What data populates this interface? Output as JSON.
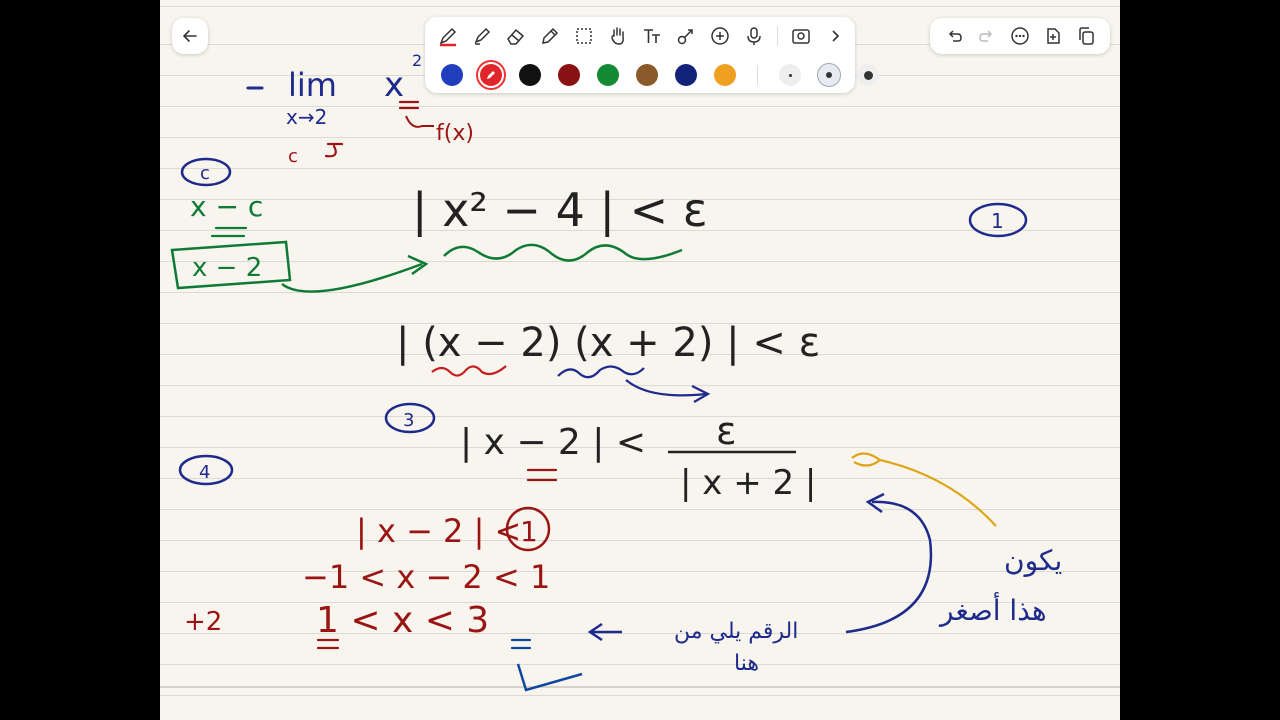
{
  "toolbar": {
    "tools": [
      "pen",
      "highlighter",
      "eraser",
      "pencil",
      "lasso-select",
      "hand",
      "text",
      "shape",
      "add",
      "microphone",
      "photo",
      "more"
    ],
    "active_tool": "pen",
    "colors": [
      "#1f3fbf",
      "#e0262b",
      "#111111",
      "#8a1212",
      "#138a36",
      "#8a5a2a",
      "#13237a",
      "#f0a020"
    ],
    "selected_color": "#e0262b",
    "stroke_widths": [
      "thin",
      "medium",
      "thick"
    ],
    "selected_width": "medium"
  },
  "header_right": {
    "buttons": [
      "undo",
      "redo",
      "more-options",
      "add-page",
      "copy-page"
    ]
  },
  "ink_colors": {
    "blue": "#1e2a8c",
    "green": "#0f7a35",
    "red": "#9a1414",
    "black": "#222222",
    "gold": "#e0a418"
  },
  "notes": {
    "limit_word": "lim",
    "limit_sub": "x→2",
    "limit_expr": "x",
    "limit_exp": "2",
    "fx_label": "f(x)",
    "c_label": "c",
    "circle_c": "c",
    "x_minus_c": "x − c",
    "boxed_x_minus_2": "x − 2",
    "step1_lhs": "| x² − 4 | < ε",
    "step1_circle": "1",
    "step2": "| (x − 2) (x + 2) | < ε",
    "step3_circle": "3",
    "step3_lhs": "| x − 2 | <",
    "step3_num": "ε",
    "step3_den": "| x + 2 |",
    "step4_circle": "4",
    "ineq1_lhs": "| x − 2 | <",
    "ineq1_circled": "1",
    "ineq2": "−1  < x − 2 < 1",
    "plus2": "+2",
    "ineq3": "1  <  x  < 3",
    "arabic_1": "يكون",
    "arabic_2": "هذا أصغر",
    "arabic_3": "الرقم يلي من",
    "arabic_4": "هنا"
  }
}
